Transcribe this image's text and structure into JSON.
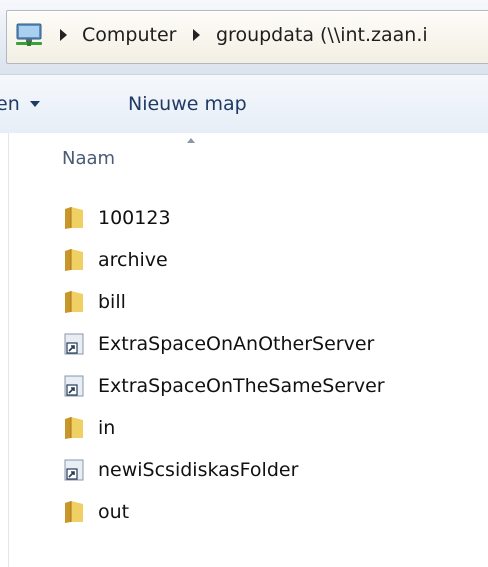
{
  "breadcrumb": {
    "items": [
      "Computer",
      "groupdata (\\\\int.zaan.i"
    ]
  },
  "toolbar": {
    "organize_partial": "en",
    "new_folder": "Nieuwe map"
  },
  "list": {
    "column_name": "Naam",
    "items": [
      {
        "name": "100123",
        "type": "folder"
      },
      {
        "name": "archive",
        "type": "folder"
      },
      {
        "name": "bill",
        "type": "folder"
      },
      {
        "name": "ExtraSpaceOnAnOtherServer",
        "type": "shortcut"
      },
      {
        "name": "ExtraSpaceOnTheSameServer",
        "type": "shortcut"
      },
      {
        "name": "in",
        "type": "folder"
      },
      {
        "name": "newiScsidiskasFolder",
        "type": "shortcut"
      },
      {
        "name": "out",
        "type": "folder"
      }
    ]
  },
  "icons": {
    "location": "network-drive-icon",
    "folder": "folder-icon",
    "shortcut": "shortcut-icon"
  },
  "colors": {
    "toolbar_text": "#1f3a64",
    "folder_yellow": "#e8c04a"
  }
}
